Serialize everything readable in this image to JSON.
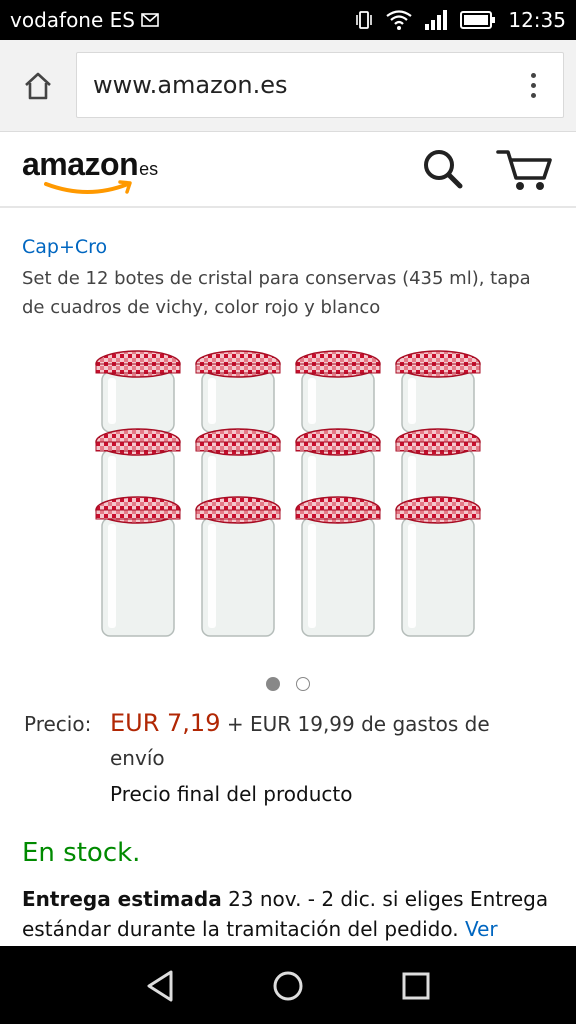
{
  "status_bar": {
    "carrier": "vodafone ES",
    "time": "12:35",
    "icons": [
      "mail-icon",
      "vibrate-icon",
      "wifi-icon",
      "signal-icon",
      "battery-icon"
    ]
  },
  "browser": {
    "url": "www.amazon.es",
    "icons": [
      "home-icon",
      "overflow-menu-icon"
    ]
  },
  "header": {
    "logo_word": "amazon",
    "logo_suffix": "es",
    "icons": [
      "search-icon",
      "cart-icon"
    ],
    "accent": "#f90"
  },
  "product": {
    "brand": "Cap+Cro",
    "title": "Set de 12 botes de cristal para conservas (435 ml), tapa de cuadros de vichy, color rojo y blanco",
    "image_alt_semantic": "twelve-glass-jars-red-gingham-lids",
    "carousel": {
      "total": 2,
      "active": 1
    },
    "price_label": "Precio:",
    "price": "EUR 7,19",
    "shipping": "+ EUR 19,99 de gastos de envío",
    "final_price_note": "Precio final del producto",
    "stock": "En stock.",
    "delivery_bold": "Entrega estimada",
    "delivery_text": "23 nov. - 2 dic. si eliges Entrega estándar durante la tramitación del pedido.",
    "delivery_link": "Ver",
    "colors": {
      "price": "#b12704",
      "stock": "#008a00",
      "link": "#0066c0"
    }
  },
  "nav_bar": {
    "icons": [
      "back-icon",
      "home-circle-icon",
      "recents-icon"
    ]
  }
}
